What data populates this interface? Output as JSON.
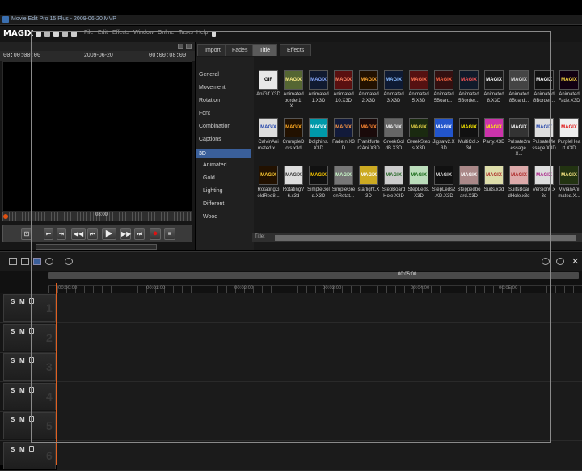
{
  "window": {
    "title": "Movie Edit Pro 15 Plus - 2009-06-20.MVP"
  },
  "menubar": {
    "logo": "MAGIX",
    "items": [
      "File",
      "Edit",
      "Effects",
      "Window",
      "Online",
      "Tasks",
      "Help"
    ]
  },
  "preview": {
    "timecode_left": "00:00:00:00",
    "date": "2009-06-20",
    "timecode_right": "00:00:08:00",
    "ruler_label": "08:00"
  },
  "tabs": [
    "Import",
    "Fades",
    "Title",
    "Effects"
  ],
  "active_tab": "Title",
  "categories": [
    "General",
    "Movement",
    "Rotation",
    "Font",
    "Combination",
    "Captions",
    "3D",
    "Animated",
    "Gold",
    "Lighting",
    "Different",
    "Wood"
  ],
  "selected_category": "3D",
  "items": [
    {
      "label": "AniGif.X3D",
      "thumb": "GIF",
      "color": "#e8e8e8",
      "text_color": "#000000"
    },
    {
      "label": "Animated border1.X...",
      "thumb": "MAGIX",
      "color": "#556633",
      "text_color": "#ffee88"
    },
    {
      "label": "Animated 1.X3D",
      "thumb": "MAGIX",
      "color": "#101a30",
      "text_color": "#88aaff"
    },
    {
      "label": "Animated 10.X3D",
      "thumb": "MAGIX",
      "color": "#5a1010",
      "text_color": "#ff8866"
    },
    {
      "label": "Animated 2.X3D",
      "thumb": "MAGIX",
      "color": "#221100",
      "text_color": "#ffaa33"
    },
    {
      "label": "Animated 3.X3D",
      "thumb": "MAGIX",
      "color": "#0e1a33",
      "text_color": "#88bbff"
    },
    {
      "label": "Animated 5.X3D",
      "thumb": "MAGIX",
      "color": "#551111",
      "text_color": "#ff7755"
    },
    {
      "label": "Animated 5Board...",
      "thumb": "MAGIX",
      "color": "#331010",
      "text_color": "#ff6644"
    },
    {
      "label": "Animated 5Border...",
      "thumb": "MAGIX",
      "color": "#101a2a",
      "text_color": "#ff5555"
    },
    {
      "label": "Animated 8.X3D",
      "thumb": "MAGIX",
      "color": "#1a1a1a",
      "text_color": "#ffffff"
    },
    {
      "label": "Animated 8Board...",
      "thumb": "MAGIX",
      "color": "#444444",
      "text_color": "#dddddd"
    },
    {
      "label": "Animated 8Border...",
      "thumb": "MAGIX",
      "color": "#111111",
      "text_color": "#ffffff"
    },
    {
      "label": "Animated Fade.X3D",
      "thumb": "MAGIX",
      "color": "#110011",
      "text_color": "#ffdd44"
    },
    {
      "label": "CalvinAni mated.x...",
      "thumb": "MAGIX",
      "color": "#dddddd",
      "text_color": "#2244aa"
    },
    {
      "label": "CrumpleD ots.x3d",
      "thumb": "MAGIX",
      "color": "#221100",
      "text_color": "#ffaa22"
    },
    {
      "label": "Dolphins. X3D",
      "thumb": "MAGIX",
      "color": "#0099aa",
      "text_color": "#ffffff"
    },
    {
      "label": "FadeIn.X3 D",
      "thumb": "MAGIX",
      "color": "#121a3a",
      "text_color": "#ff9944"
    },
    {
      "label": "Frankfurte r2Ani.X3D",
      "thumb": "MAGIX",
      "color": "#1a0a0a",
      "text_color": "#ff8833"
    },
    {
      "label": "GreekGol dB.X3D",
      "thumb": "MAGIX",
      "color": "#666666",
      "text_color": "#eeeeee"
    },
    {
      "label": "GreekStep s.X3D",
      "thumb": "MAGIX",
      "color": "#1a2a10",
      "text_color": "#ddcc44"
    },
    {
      "label": "Jigsaw2.X 3D",
      "thumb": "MAGIX",
      "color": "#2255cc",
      "text_color": "#ffffff"
    },
    {
      "label": "MultiCol.x 3d",
      "thumb": "MAGIX",
      "color": "#111111",
      "text_color": "#ffee00"
    },
    {
      "label": "Party.X3D",
      "thumb": "MAGIX",
      "color": "#cc33aa",
      "text_color": "#ffff00"
    },
    {
      "label": "Pulsate2m essage.X...",
      "thumb": "MAGIX",
      "color": "#333333",
      "text_color": "#ffffff"
    },
    {
      "label": "PulsateMe ssage.X3D",
      "thumb": "MAGIX",
      "color": "#dddddd",
      "text_color": "#2244aa"
    },
    {
      "label": "PurpleHea rt.X3D",
      "thumb": "MAGIX",
      "color": "#eeeeee",
      "text_color": "#dd1111"
    },
    {
      "label": "RotatingG oldRed8...",
      "thumb": "MAGIX",
      "color": "#221100",
      "text_color": "#ffcc33"
    },
    {
      "label": "RotatingV 6.x3d",
      "thumb": "MAGIX",
      "color": "#dddddd",
      "text_color": "#333333"
    },
    {
      "label": "SimpleGol d.X3D",
      "thumb": "MAGIX",
      "color": "#111111",
      "text_color": "#ffcc00"
    },
    {
      "label": "SimpleGre enRotat...",
      "thumb": "MAGIX",
      "color": "#777777",
      "text_color": "#ccffcc"
    },
    {
      "label": "starlight.X 3D",
      "thumb": "MAGIX",
      "color": "#ccaa22",
      "text_color": "#ffffff"
    },
    {
      "label": "StepBoard Hole.X3D",
      "thumb": "MAGIX",
      "color": "#cccccc",
      "text_color": "#226622"
    },
    {
      "label": "StepLeds. X3D",
      "thumb": "MAGIX",
      "color": "#bbddbb",
      "text_color": "#116611"
    },
    {
      "label": "StepLeds2 .XD.X3D",
      "thumb": "MAGIX",
      "color": "#111111",
      "text_color": "#dddddd"
    },
    {
      "label": "Steppedbo ard.X3D",
      "thumb": "MAGIX",
      "color": "#aa8888",
      "text_color": "#ffffff"
    },
    {
      "label": "Suits.x3d",
      "thumb": "MAGIX",
      "color": "#ddddaa",
      "text_color": "#aa2222"
    },
    {
      "label": "SuitsBoar dHole.x3d",
      "thumb": "MAGIX",
      "color": "#ddaaaa",
      "text_color": "#aa2222"
    },
    {
      "label": "Version6.x 3d",
      "thumb": "MAGIX",
      "color": "#dddddd",
      "text_color": "#aa2288"
    },
    {
      "label": "VivianAni mated.X...",
      "thumb": "MAGIX",
      "color": "#223311",
      "text_color": "#ffee88"
    }
  ],
  "title_field": {
    "label": "Title:",
    "value": ""
  },
  "timeline": {
    "scroll_label": "00:05:00",
    "ticks": [
      "00:00:00",
      "00:01:00",
      "00:02:00",
      "00:03:00",
      "00:04:00",
      "00:05:00"
    ],
    "tracks": [
      {
        "s": "S",
        "m": "M",
        "num": "1"
      },
      {
        "s": "S",
        "m": "M",
        "num": "2"
      },
      {
        "s": "S",
        "m": "M",
        "num": "3"
      },
      {
        "s": "S",
        "m": "M",
        "num": "4"
      },
      {
        "s": "S",
        "m": "M",
        "num": "5"
      },
      {
        "s": "S",
        "m": "M",
        "num": "6"
      }
    ]
  },
  "colors": {
    "accent": "#3a5f9a",
    "playhead": "#e06020",
    "record": "#dd1111"
  }
}
